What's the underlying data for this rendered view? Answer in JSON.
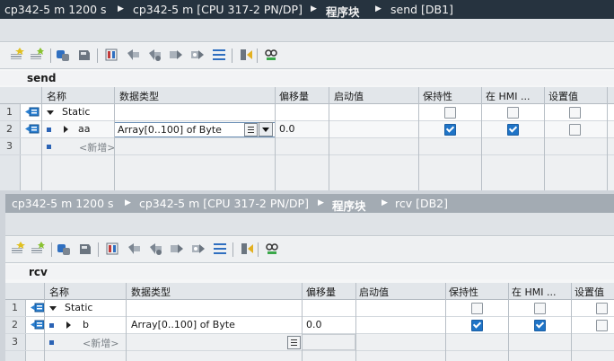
{
  "colors": {
    "title_active": "#26333f",
    "title_inactive": "#a3abb3",
    "checkbox_on": "#1f74c7"
  },
  "panes": [
    {
      "breadcrumb": [
        "cp342-5 m 1200 s",
        "cp342-5 m [CPU 317-2 PN/DP]",
        "程序块",
        "send [DB1]"
      ],
      "block_name": "send",
      "columns": [
        "名称",
        "数据类型",
        "偏移量",
        "启动值",
        "保持性",
        "在 HMI ...",
        "设置值"
      ],
      "rows": [
        {
          "num": "1",
          "name": "Static",
          "type": "",
          "offset": "",
          "retain": false,
          "hmi": false,
          "setpoint": false
        },
        {
          "num": "2",
          "name": "aa",
          "type": "Array[0..100] of Byte",
          "offset": "0.0",
          "retain": true,
          "hmi": true,
          "setpoint": false
        },
        {
          "num": "3",
          "name": "<新增>",
          "type": "",
          "offset": ""
        }
      ]
    },
    {
      "breadcrumb": [
        "cp342-5 m 1200 s",
        "cp342-5 m [CPU 317-2 PN/DP]",
        "程序块",
        "rcv [DB2]"
      ],
      "block_name": "rcv",
      "columns": [
        "名称",
        "数据类型",
        "偏移量",
        "启动值",
        "保持性",
        "在 HMI ...",
        "设置值"
      ],
      "rows": [
        {
          "num": "1",
          "name": "Static",
          "type": "",
          "offset": "",
          "retain": false,
          "hmi": false,
          "setpoint": false
        },
        {
          "num": "2",
          "name": "b",
          "type": "Array[0..100] of Byte",
          "offset": "0.0",
          "retain": true,
          "hmi": true,
          "setpoint": false
        },
        {
          "num": "3",
          "name": "<新增>",
          "type": "",
          "offset": ""
        }
      ]
    }
  ],
  "toolbar_icons": [
    "insert-row-icon",
    "add-row-icon",
    "expand-icon",
    "save-snapshot-icon",
    "reset-start-values-icon",
    "copy-snapshot-icon",
    "copy-snapshot-to-start-icon",
    "load-snapshot-icon",
    "load-start-values-icon",
    "list-view-icon",
    "keep-actual-values-icon",
    "monitor-all-icon"
  ]
}
